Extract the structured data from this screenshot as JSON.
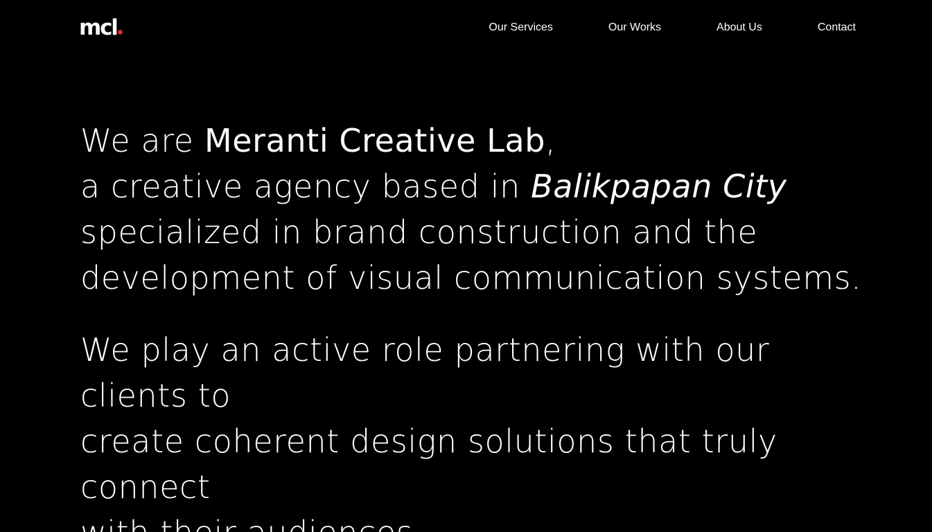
{
  "colors": {
    "background": "#000000",
    "text": "#ffffff",
    "accent": "#e0243a"
  },
  "logo": {
    "text": "mcl"
  },
  "nav": {
    "items": [
      {
        "label": "Our Services"
      },
      {
        "label": "Our Works"
      },
      {
        "label": "About Us"
      },
      {
        "label": "Contact"
      }
    ]
  },
  "hero": {
    "intro": {
      "prefix": "We are ",
      "company": "Meranti Creative Lab",
      "comma": ",",
      "line2_prefix": "a creative agency based in ",
      "city": "Balikpapan City",
      "line3": "specialized in brand construction and the",
      "line4": "development of visual communication systems."
    },
    "mission": {
      "line1": "We play an active role partnering with our clients to",
      "line2": "create coherent design solutions that truly connect",
      "line3": "with their audiences."
    }
  }
}
